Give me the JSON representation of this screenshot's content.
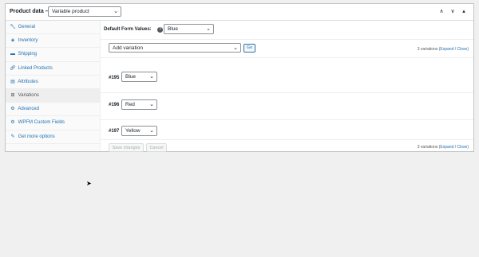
{
  "header": {
    "title": "Product data —",
    "product_type": "Variable product",
    "icons": [
      "chevron-up-icon",
      "chevron-down-icon",
      "triangle-up-icon"
    ]
  },
  "sidebar": {
    "items": [
      {
        "label": "General",
        "icon": "wrench-icon"
      },
      {
        "label": "Inventory",
        "icon": "tag-icon"
      },
      {
        "label": "Shipping",
        "icon": "truck-icon"
      },
      {
        "label": "Linked Products",
        "icon": "link-icon"
      },
      {
        "label": "Attributes",
        "icon": "list-icon"
      },
      {
        "label": "Variations",
        "icon": "grid-icon"
      },
      {
        "label": "Advanced",
        "icon": "gear-icon"
      },
      {
        "label": "WPFM Custom Fields",
        "icon": "gear-icon"
      },
      {
        "label": "Get more options",
        "icon": "plugin-icon"
      }
    ]
  },
  "variations": {
    "default_label": "Default Form Values:",
    "default_value": "Blue",
    "add_select": "Add variation",
    "go_label": "Go",
    "count_text": "3 variations (",
    "expand": "Expand",
    "sep": " / ",
    "close": "Close",
    "close_paren": ")",
    "items": [
      {
        "id": "#195",
        "value": "Blue"
      },
      {
        "id": "#196",
        "value": "Red"
      },
      {
        "id": "#197",
        "value": "Yellow"
      }
    ],
    "save_label": "Save changes",
    "cancel_label": "Cancel"
  }
}
